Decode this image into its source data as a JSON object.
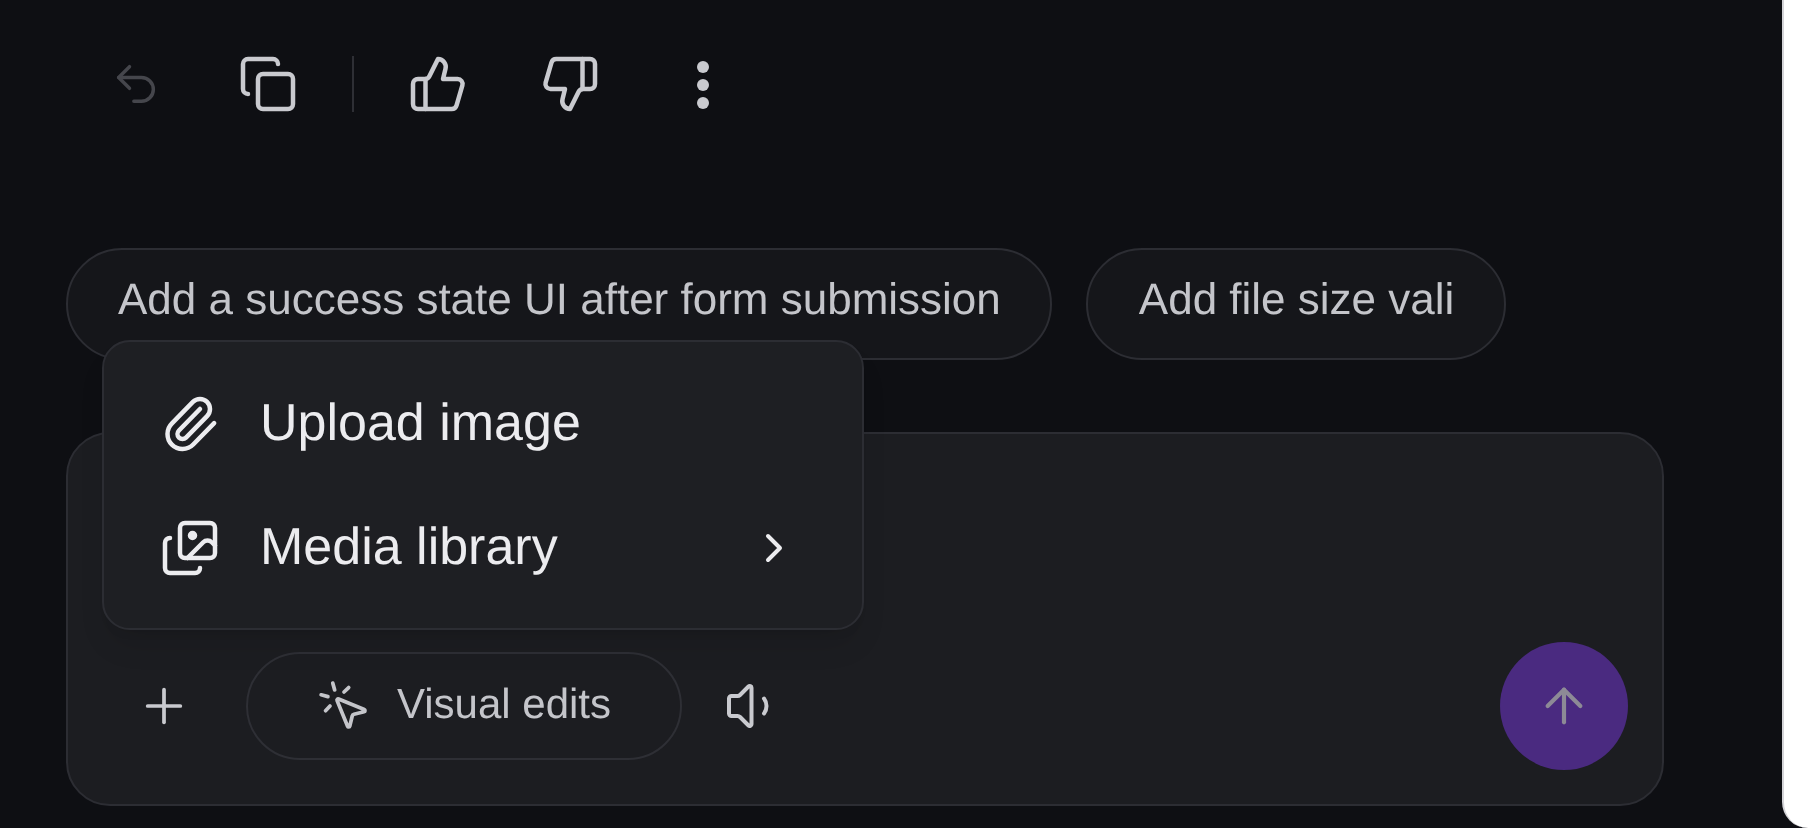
{
  "toolbar": {
    "undo": {
      "disabled": true
    },
    "copy": {
      "disabled": false
    },
    "like": {
      "selected": false
    },
    "dislike": {
      "selected": false
    }
  },
  "suggestions": [
    {
      "label": "Add a success state UI after form submission"
    },
    {
      "label": "Add file size vali"
    }
  ],
  "attach_menu": {
    "items": [
      {
        "kind": "action",
        "label": "Upload image"
      },
      {
        "kind": "submenu",
        "label": "Media library"
      }
    ]
  },
  "composer": {
    "visual_edits": {
      "label": "Visual edits"
    },
    "send_button": {
      "disabled": true
    }
  }
}
